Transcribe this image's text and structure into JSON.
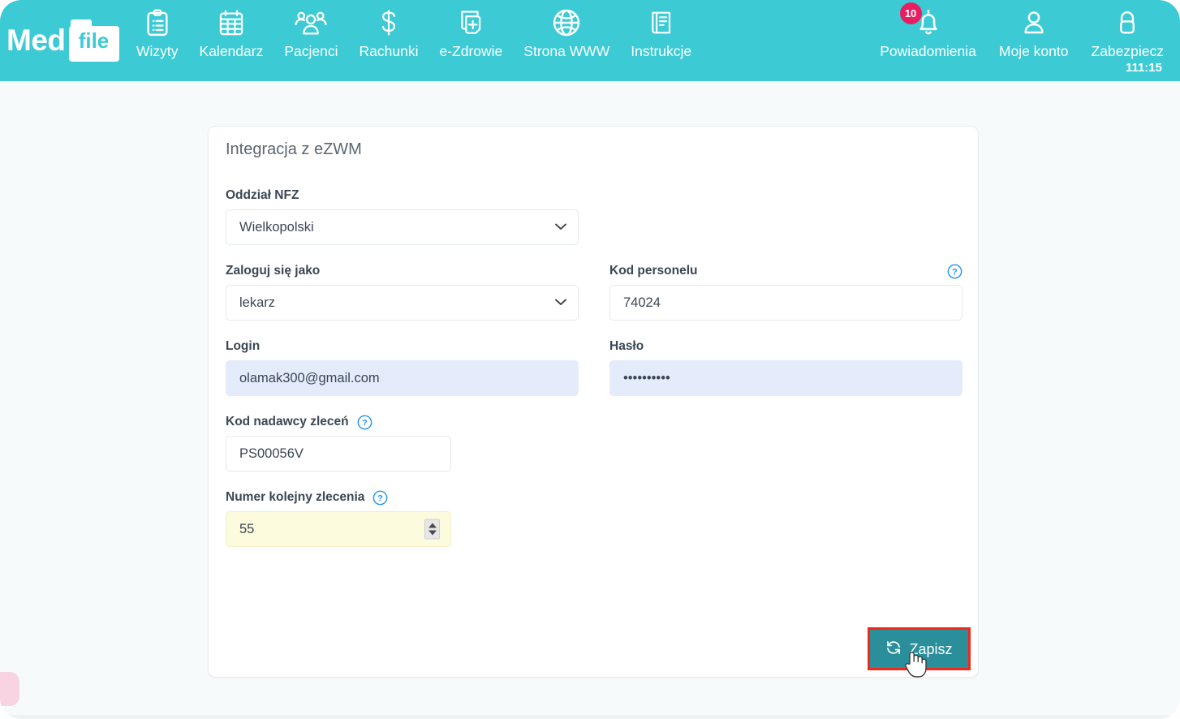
{
  "navbar": {
    "brand": {
      "word1": "Med",
      "word2": "file"
    },
    "items": [
      {
        "label": "Wizyty",
        "icon": "clipboard-icon"
      },
      {
        "label": "Kalendarz",
        "icon": "calendar-icon"
      },
      {
        "label": "Pacjenci",
        "icon": "people-icon"
      },
      {
        "label": "Rachunki",
        "icon": "dollar-icon"
      },
      {
        "label": "e-Zdrowie",
        "icon": "medical-file-icon"
      },
      {
        "label": "Strona WWW",
        "icon": "globe-icon"
      },
      {
        "label": "Instrukcje",
        "icon": "book-icon"
      }
    ],
    "right_items": [
      {
        "label": "Powiadomienia",
        "icon": "bell-icon",
        "badge": "10"
      },
      {
        "label": "Moje konto",
        "icon": "user-icon"
      },
      {
        "label": "Zabezpiecz",
        "icon": "lock-icon",
        "timer": "111:15"
      }
    ],
    "colors": {
      "background": "#3ccbd5",
      "badge": "#e81e63",
      "text": "#ffffff"
    }
  },
  "card": {
    "title": "Integracja z eZWM",
    "fields": {
      "oddzial_nfz": {
        "label": "Oddział NFZ",
        "value": "Wielkopolski",
        "options": [
          "Wielkopolski"
        ]
      },
      "zaloguj_jako": {
        "label": "Zaloguj się jako",
        "value": "lekarz",
        "options": [
          "lekarz"
        ]
      },
      "kod_personelu": {
        "label": "Kod personelu",
        "value": "74024",
        "help": "?"
      },
      "login": {
        "label": "Login",
        "value": "olamak300@gmail.com"
      },
      "haslo": {
        "label": "Hasło",
        "value": "••••••••••"
      },
      "kod_nadawcy": {
        "label": "Kod nadawcy zleceń",
        "value": "PS00056V",
        "help": "?"
      },
      "numer_kolejny": {
        "label": "Numer kolejny zlecenia",
        "value": "55",
        "help": "?"
      }
    },
    "save_button": {
      "label": "Zapisz",
      "icon": "sync-icon"
    },
    "colors": {
      "save_background": "#2a8f9b",
      "highlight_border": "#f0291a",
      "autofill_blue": "#e4ebfa",
      "autofill_yellow": "#fcfbdd",
      "help_icon": "#2196f3"
    }
  }
}
